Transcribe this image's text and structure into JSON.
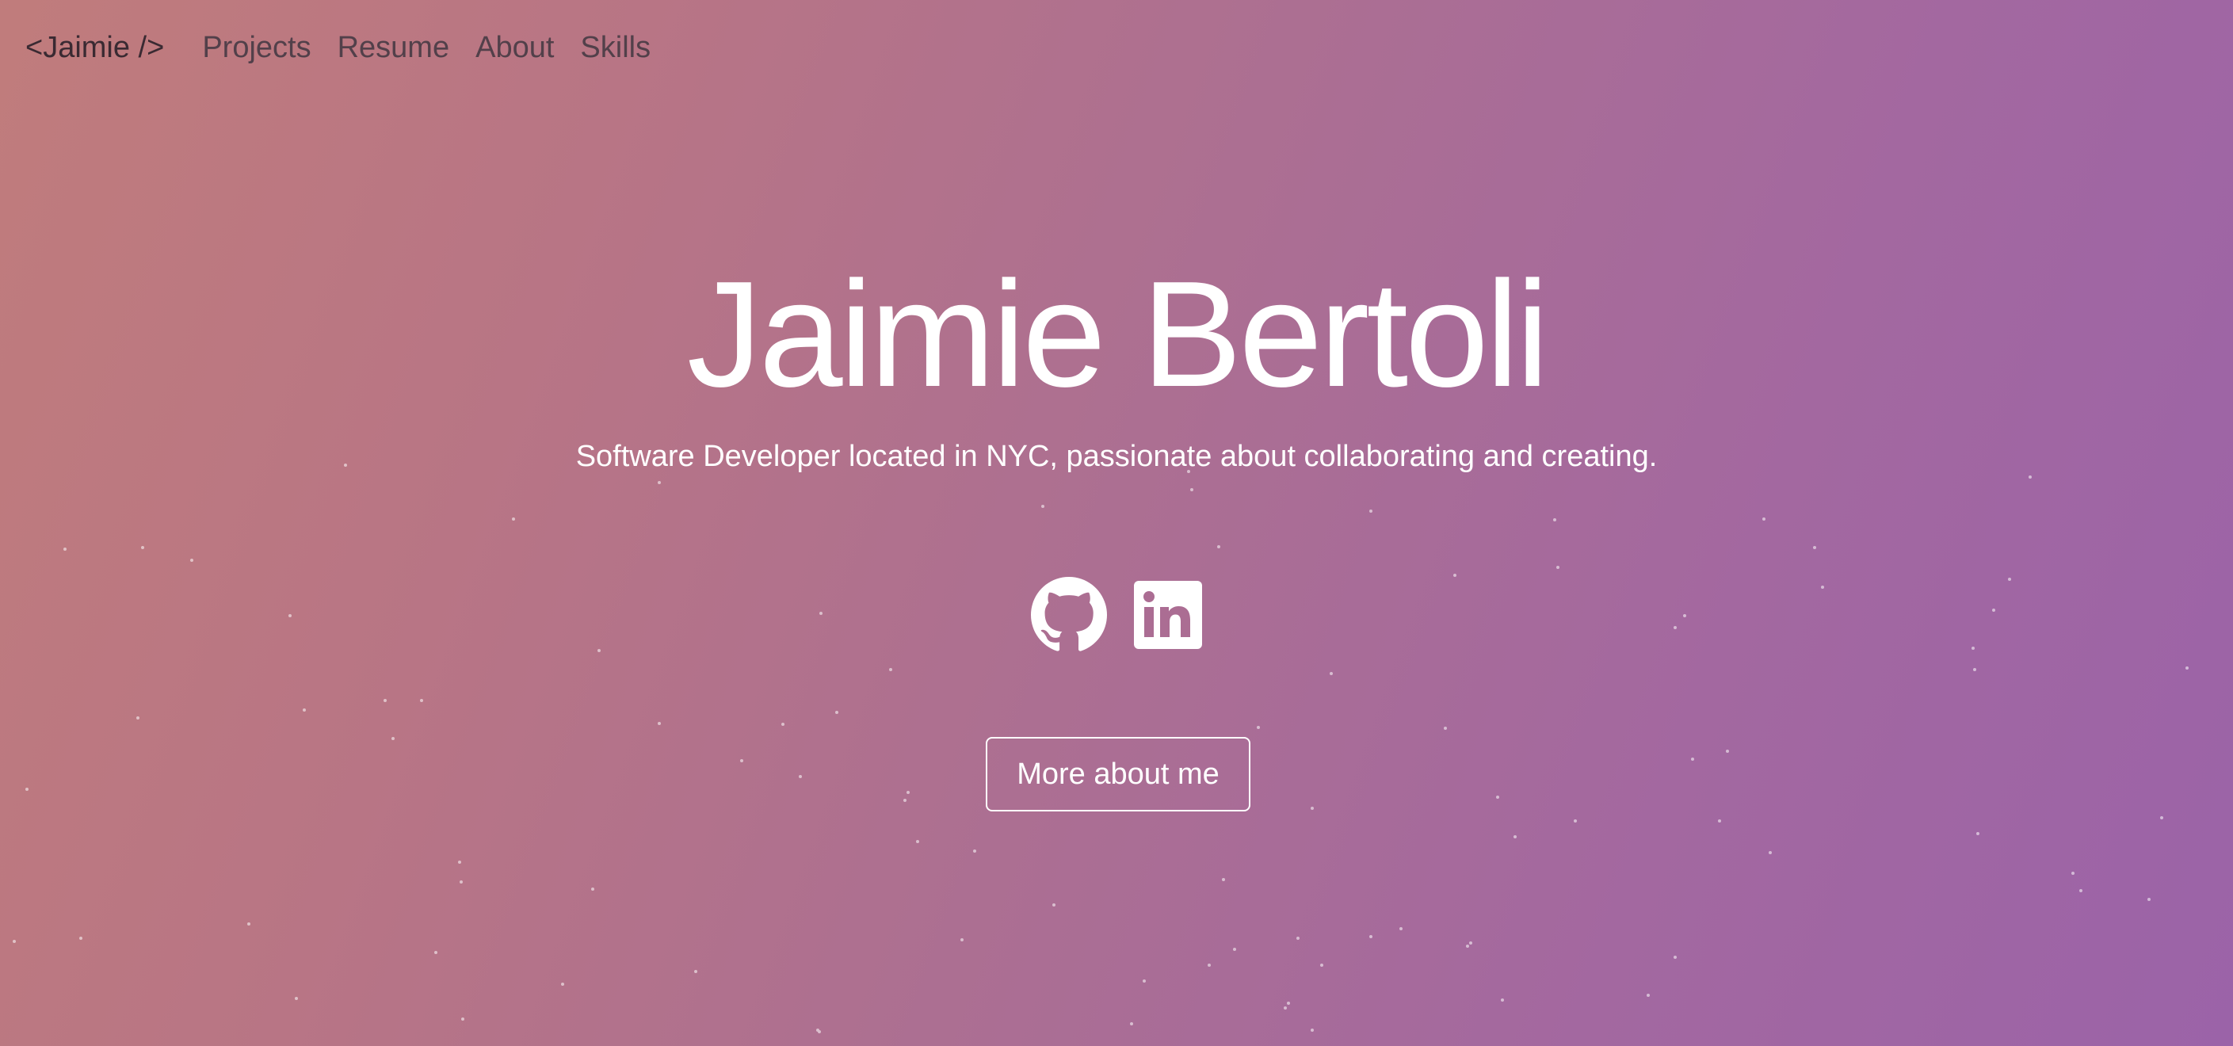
{
  "nav": {
    "brand": "<Jaimie />",
    "links": [
      "Projects",
      "Resume",
      "About",
      "Skills"
    ]
  },
  "hero": {
    "name": "Jaimie Bertoli",
    "tagline": "Software Developer located in NYC, passionate about collaborating and creating.",
    "cta_label": "More about me"
  },
  "socials": [
    {
      "icon": "github-icon"
    },
    {
      "icon": "linkedin-icon"
    }
  ],
  "colors": {
    "gradient_start": "#c07c7c",
    "gradient_end": "#9b63a8",
    "text": "#ffffff",
    "nav_text": "#52404a"
  }
}
